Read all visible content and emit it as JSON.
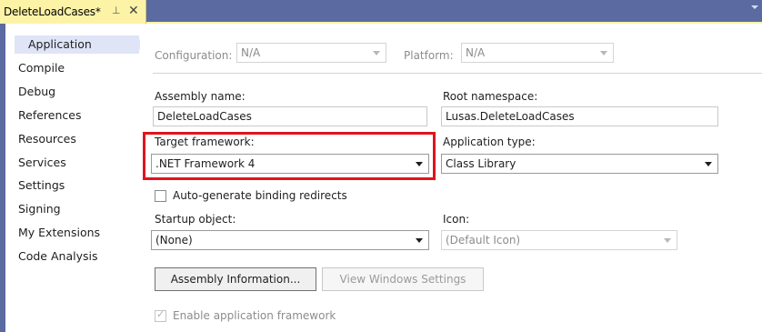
{
  "tab": {
    "title": "DeleteLoadCases*",
    "pin_glyph": "⊥",
    "close_glyph": "✕"
  },
  "sidebar": {
    "items": [
      {
        "label": "Application",
        "selected": true
      },
      {
        "label": "Compile"
      },
      {
        "label": "Debug"
      },
      {
        "label": "References"
      },
      {
        "label": "Resources"
      },
      {
        "label": "Services"
      },
      {
        "label": "Settings"
      },
      {
        "label": "Signing"
      },
      {
        "label": "My Extensions"
      },
      {
        "label": "Code Analysis"
      }
    ]
  },
  "config": {
    "configuration_label": "Configuration:",
    "configuration_value": "N/A",
    "platform_label": "Platform:",
    "platform_value": "N/A"
  },
  "form": {
    "assembly_name_label": "Assembly name:",
    "assembly_name_value": "DeleteLoadCases",
    "root_namespace_label": "Root namespace:",
    "root_namespace_value": "Lusas.DeleteLoadCases",
    "target_framework_label": "Target framework:",
    "target_framework_value": ".NET Framework 4",
    "application_type_label": "Application type:",
    "application_type_value": "Class Library",
    "binding_redirects_label": "Auto-generate binding redirects",
    "startup_object_label": "Startup object:",
    "startup_object_value": "(None)",
    "icon_label": "Icon:",
    "icon_value": "(Default Icon)",
    "assembly_info_button": "Assembly Information...",
    "view_windows_settings_button": "View Windows Settings",
    "enable_app_framework_label": "Enable application framework"
  },
  "colors": {
    "tab_active": "#fcf3a6",
    "chrome": "#5b6aa0",
    "highlight_border": "#e0141c",
    "selected_nav": "#dfe5f7"
  }
}
